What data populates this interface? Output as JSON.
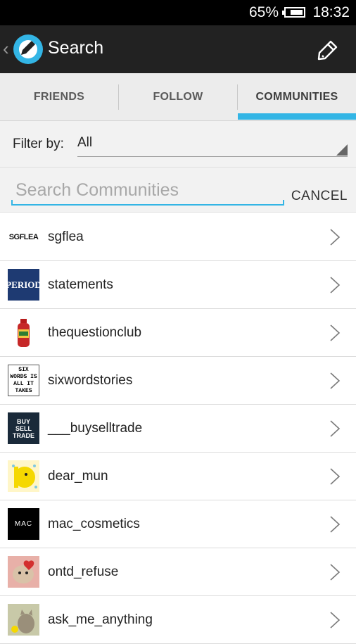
{
  "status": {
    "battery_percent": "65%",
    "time": "18:32",
    "battery_level": 0.65
  },
  "header": {
    "title": "Search",
    "back_icon": "chevron-left-icon",
    "compose_icon": "compose-icon"
  },
  "tabs": [
    {
      "label": "FRIENDS",
      "selected": false
    },
    {
      "label": "FOLLOW",
      "selected": false
    },
    {
      "label": "COMMUNITIES",
      "selected": true
    }
  ],
  "filter": {
    "label": "Filter by:",
    "value": "All"
  },
  "search": {
    "placeholder": "Search Communities",
    "cancel_label": "CANCEL"
  },
  "communities": [
    {
      "name": "sgflea",
      "thumb_text": "SGFLEA"
    },
    {
      "name": "statements",
      "thumb_text": "PERIOD"
    },
    {
      "name": "thequestionclub",
      "thumb_text": ""
    },
    {
      "name": "sixwordstories",
      "thumb_text": "SIX WORDS IS ALL IT TAKES"
    },
    {
      "name": "___buyselltrade",
      "thumb_text": "BUY SELL TRADE"
    },
    {
      "name": "dear_mun",
      "thumb_text": ""
    },
    {
      "name": "mac_cosmetics",
      "thumb_text": "MAC"
    },
    {
      "name": "ontd_refuse",
      "thumb_text": ""
    },
    {
      "name": "ask_me_anything",
      "thumb_text": ""
    }
  ],
  "colors": {
    "accent": "#33b5e5",
    "action_bar": "#222222",
    "tab_bar": "#ececec"
  }
}
